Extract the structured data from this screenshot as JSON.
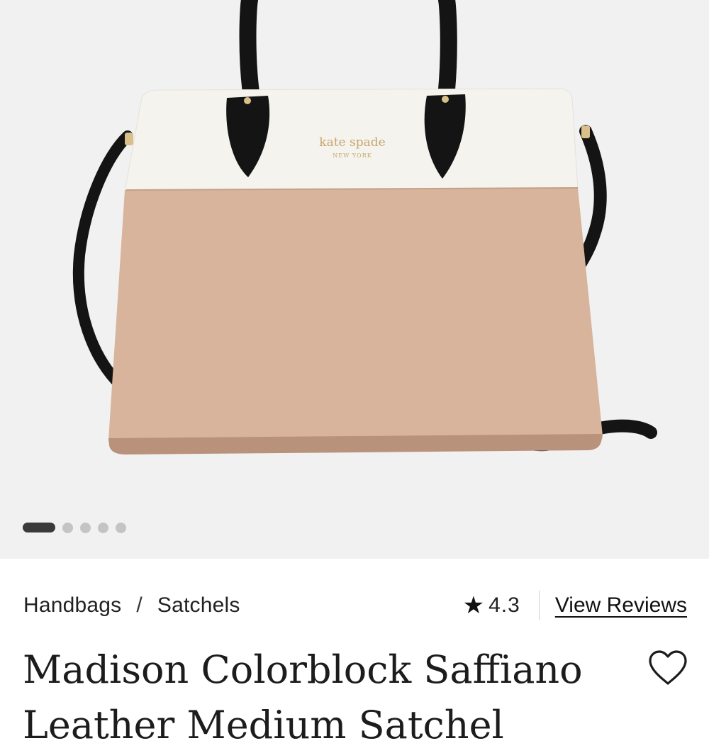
{
  "product": {
    "image_brand": "kate spade",
    "image_brand_sub": "NEW YORK",
    "gallery": {
      "count": 5,
      "active_index": 0
    },
    "breadcrumb": [
      "Handbags",
      "Satchels"
    ],
    "breadcrumb_separator": "/",
    "rating": "4.3",
    "view_reviews_label": "View Reviews",
    "title": "Madison Colorblock Saffiano Leather Medium Satchel"
  },
  "icons": {
    "star": "star-icon",
    "wishlist": "heart-icon"
  },
  "colors": {
    "bag_body": "#d9b49c",
    "bag_top": "#f4f3ee",
    "strap": "#141414",
    "hardware": "#c9a66b"
  }
}
